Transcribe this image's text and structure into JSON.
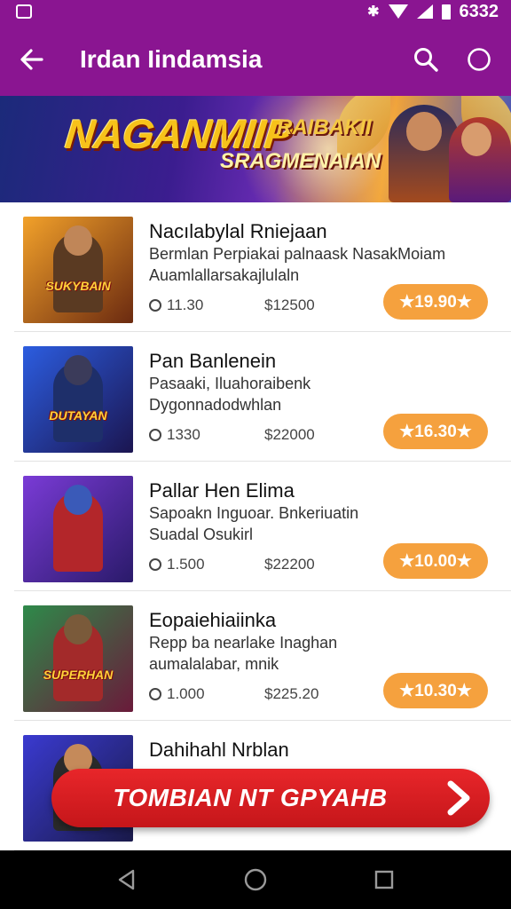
{
  "status_bar": {
    "time": "6332",
    "icons": [
      "photo-icon",
      "notification-icon",
      "wifi-icon",
      "signal-icon",
      "battery-icon"
    ]
  },
  "app_bar": {
    "title": "Irdan Iindamsia",
    "icons": [
      "back-arrow-icon",
      "search-icon",
      "circle-more-icon"
    ]
  },
  "banner": {
    "title": "NAGANMIIP",
    "subtitle_a": "RAIBAKII",
    "subtitle_b": "SRAGMENAIAN"
  },
  "items": [
    {
      "title": "Nacılabylal Rniejaan",
      "desc_1": "Bermlan Perpiakai palnaask NasakMoiam",
      "desc_2": "Auamlallarsakajlulaln",
      "stat_1": "11.30",
      "stat_2": "$12500",
      "price": "★19.90★",
      "thumb_text": "SUKYBAIN",
      "colors": {
        "bg1": "#f2a12a",
        "bg2": "#6b2a10",
        "figure": "#5a3a22",
        "head": "#c08658"
      }
    },
    {
      "title": "Pan Banlenein",
      "desc_1": "Pasaaki, Iluahoraibenk",
      "desc_2": "Dygonnadodwhlan",
      "stat_1": "1330",
      "stat_2": "$22000",
      "price": "★16.30★",
      "thumb_text": "DUTAYAN",
      "colors": {
        "bg1": "#2c5de0",
        "bg2": "#1b1550",
        "figure": "#1e2f6a",
        "head": "#3b3b5a"
      }
    },
    {
      "title": "Pallar Hen Elima",
      "desc_1": "Sapoakn Inguoar. Bnkeriuatin",
      "desc_2": "Suadal Osukirl",
      "stat_1": "1.500",
      "stat_2": "$22200",
      "price": "★10.00★",
      "thumb_text": "",
      "colors": {
        "bg1": "#7a3bd6",
        "bg2": "#2a1a6a",
        "figure": "#b3262a",
        "head": "#3a5ab8"
      }
    },
    {
      "title": "Eopaiehiaiinka",
      "desc_1": "Repp ba nearlake Inaghan",
      "desc_2": "aumalalabar, mnik",
      "stat_1": "1.000",
      "stat_2": "$225.20",
      "price": "★10.30★",
      "thumb_text": "SUPERHAN",
      "colors": {
        "bg1": "#2e8a4a",
        "bg2": "#6a1a3a",
        "figure": "#a32a2a",
        "head": "#7a5a3a"
      }
    },
    {
      "title": "Dahihahl Nrblan",
      "desc_1": "",
      "desc_2": "",
      "stat_1": "",
      "stat_2": "",
      "price": "",
      "thumb_text": "",
      "colors": {
        "bg1": "#3a3ad0",
        "bg2": "#1a1a4a",
        "figure": "#2a2a2a",
        "head": "#c58a5a"
      }
    }
  ],
  "cta": {
    "label": "TOMBIAN NT GPYAHB",
    "icon": "chevron-right-icon",
    "color": "#e0222a"
  },
  "nav_bar": {
    "icons": [
      "back-triangle-icon",
      "home-circle-icon",
      "recents-square-icon"
    ]
  },
  "colors": {
    "primary": "#8a1591",
    "accent": "#f5a13e"
  }
}
